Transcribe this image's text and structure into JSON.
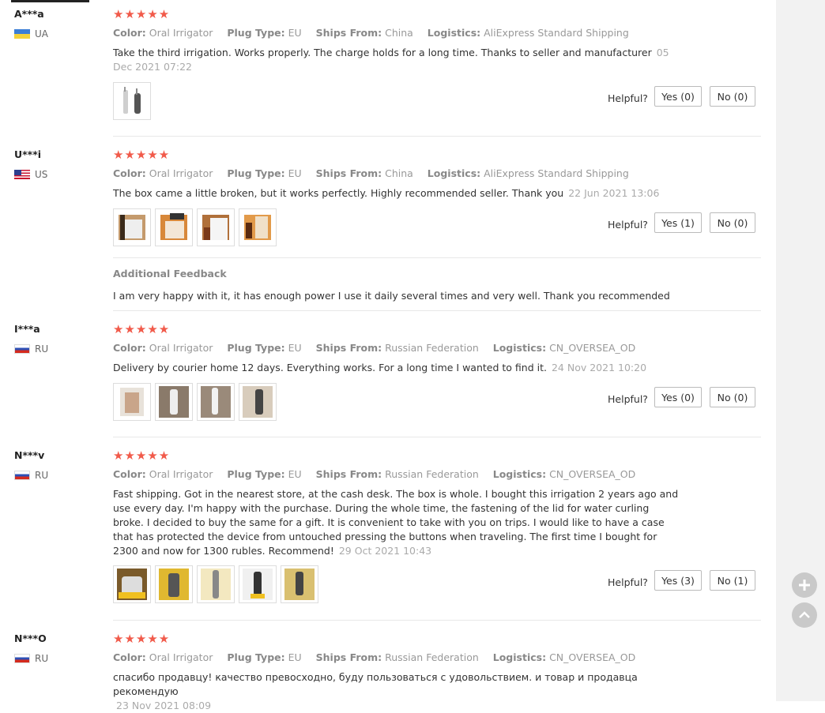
{
  "labels": {
    "color": "Color:",
    "plug_type": "Plug Type:",
    "ships_from": "Ships From:",
    "logistics": "Logistics:",
    "helpful": "Helpful?",
    "stars": "★★★★★",
    "additional_feedback_title": "Additional Feedback"
  },
  "reviews": [
    {
      "user": "A***a",
      "country": "UA",
      "rating": 5,
      "color": "Oral Irrigator",
      "plug_type": "EU",
      "ships_from": "China",
      "logistics": "AliExpress Standard Shipping",
      "text": "Take the third irrigation. Works properly. The charge holds for a long time. Thanks to seller and manufacturer",
      "date": "05 Dec 2021 07:22",
      "yes": "Yes (0)",
      "no": "No (0)"
    },
    {
      "user": "U***i",
      "country": "US",
      "rating": 5,
      "color": "Oral Irrigator",
      "plug_type": "EU",
      "ships_from": "China",
      "logistics": "AliExpress Standard Shipping",
      "text": "The box came a little broken, but it works perfectly. Highly recommended seller. Thank you",
      "date": "22 Jun 2021 13:06",
      "yes": "Yes (1)",
      "no": "No (0)",
      "additional_feedback": "I am very happy with it, it has enough power I use it daily several times and very well. Thank you recommended"
    },
    {
      "user": "I***a",
      "country": "RU",
      "rating": 5,
      "color": "Oral Irrigator",
      "plug_type": "EU",
      "ships_from": "Russian Federation",
      "logistics": "CN_OVERSEA_OD",
      "text": "Delivery by courier home 12 days. Everything works. For a long time I wanted to find it.",
      "date": "24 Nov 2021 10:20",
      "yes": "Yes (0)",
      "no": "No (0)"
    },
    {
      "user": "N***v",
      "country": "RU",
      "rating": 5,
      "color": "Oral Irrigator",
      "plug_type": "EU",
      "ships_from": "Russian Federation",
      "logistics": "CN_OVERSEA_OD",
      "text": "Fast shipping. Got in the nearest store, at the cash desk. The box is whole. I bought this irrigation 2 years ago and use every day. I'm happy with the purchase. During the whole time, the fastening of the lid for water curling broke. I decided to buy the same for a gift. It is convenient to take with you on trips. I would like to have a case that has protected the device from untouched pressing the buttons when traveling. The first time I bought for 2300 and now for 1300 rubles. Recommend!",
      "date": "29 Oct 2021 10:43",
      "yes": "Yes (3)",
      "no": "No (1)"
    },
    {
      "user": "N***O",
      "country": "RU",
      "rating": 5,
      "color": "Oral Irrigator",
      "plug_type": "EU",
      "ships_from": "Russian Federation",
      "logistics": "CN_OVERSEA_OD",
      "text": "спасибо продавцу! качество превосходно, буду пользоваться с удовольствием. и товар и продавца рекомендую",
      "date": "23 Nov 2021 08:09"
    }
  ],
  "side_buttons": {
    "add_icon": "plus-icon",
    "top_icon": "chevron-up-icon"
  },
  "colors": {
    "star": "#f15a4a",
    "muted": "#999999",
    "border": "#bbbbbb"
  }
}
